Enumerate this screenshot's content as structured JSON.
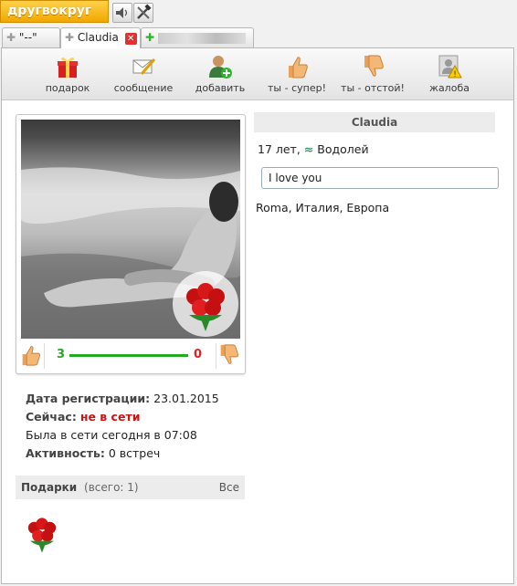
{
  "app": {
    "logo_text": "другвокруг"
  },
  "tabs": [
    {
      "label": "\"--\""
    },
    {
      "label": "Claudia"
    },
    {
      "label": ""
    }
  ],
  "toolbar": {
    "gift": "подарок",
    "message": "сообщение",
    "add": "добавить",
    "super": "ты - супер!",
    "bad": "ты - отстой!",
    "complaint": "жалоба"
  },
  "profile": {
    "name": "Claudia",
    "age_text": "17 лет,",
    "zodiac": "Водолей",
    "status_message": "I love you",
    "location": "Roma, Италия, Европа"
  },
  "rating": {
    "likes": "3",
    "dislikes": "0"
  },
  "info": {
    "reg_label": "Дата регистрации:",
    "reg_value": "23.01.2015",
    "now_label": "Сейчас:",
    "now_value": "не в сети",
    "last_seen": "Была в сети сегодня в 07:08",
    "activity_label": "Активность:",
    "activity_value": "0 встреч"
  },
  "gifts": {
    "title": "Подарки",
    "count": "(всего: 1)",
    "all_link": "Все"
  },
  "colors": {
    "logo": "#f0a800",
    "likes": "#22aa22",
    "dislikes": "#dd2222",
    "offline": "#cc1111"
  }
}
